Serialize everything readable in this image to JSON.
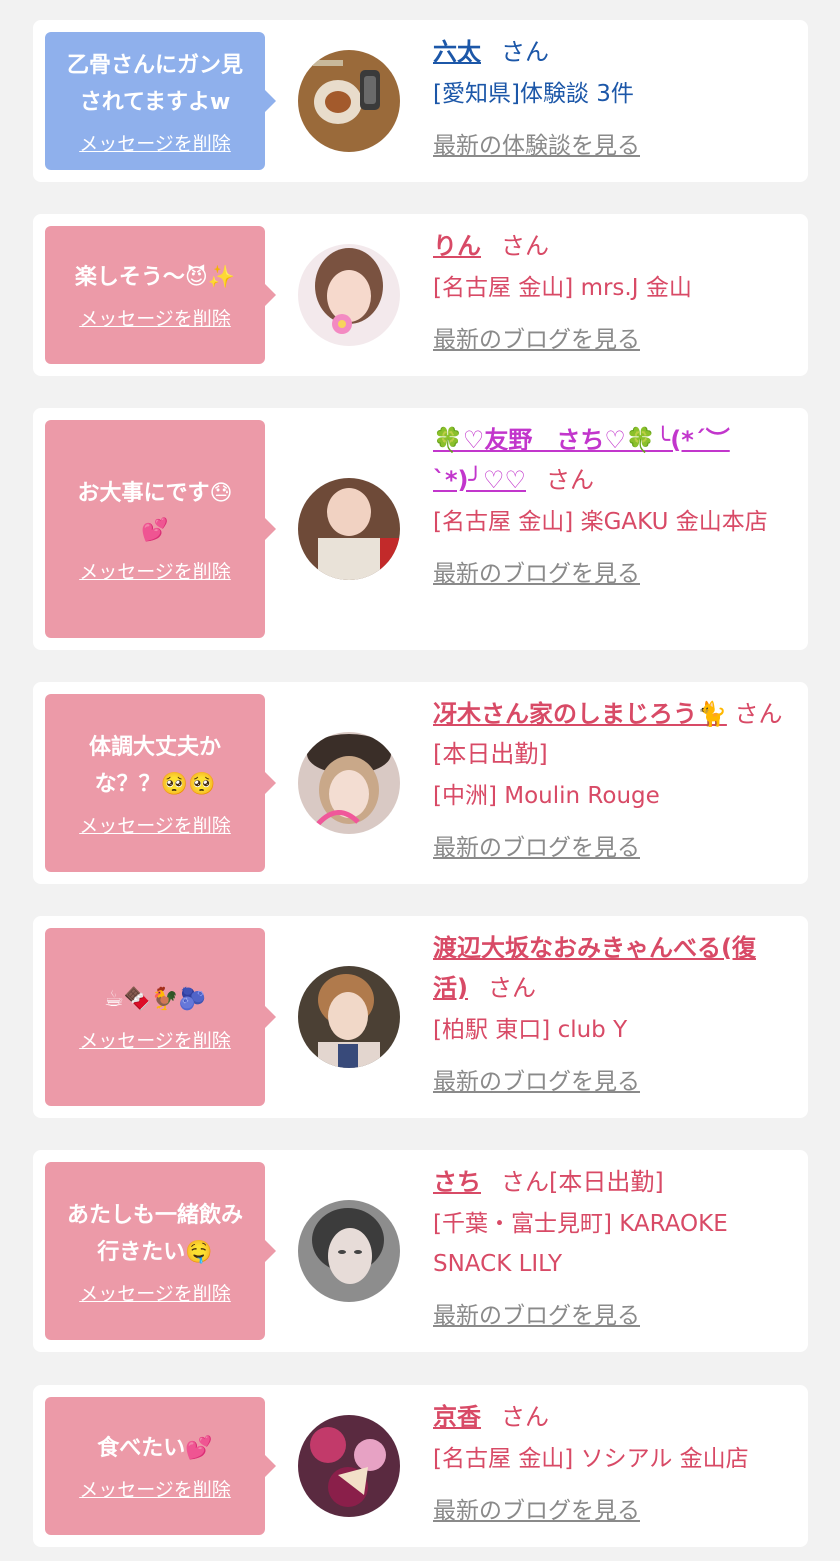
{
  "cards": [
    {
      "message": "乙骨さんにガン見\nされてますよw",
      "delete_label": "メッセージを削除",
      "name": "六太",
      "san": "さん",
      "shop": "[愛知県]体験談 3件",
      "latest": "最新の体験談を見る",
      "bubble_color": "#8fb0ec",
      "text_color": "#1c57a8"
    },
    {
      "message": "楽しそう〜😈✨",
      "delete_label": "メッセージを削除",
      "name": "りん",
      "san": "さん",
      "shop": "[名古屋 金山] mrs.J 金山",
      "latest": "最新のブログを見る",
      "bubble_color": "#ec9aa8",
      "text_color": "#d84a66"
    },
    {
      "message": "お大事にです😓\n💕",
      "delete_label": "メッセージを削除",
      "name": "🍀♡友野　さち♡🍀╰(*´︶`*)╯♡♡",
      "san": "さん",
      "shop": "[名古屋 金山] 楽GAKU 金山本店",
      "latest": "最新のブログを見る",
      "bubble_color": "#ec9aa8",
      "text_color": "#d84a66"
    },
    {
      "message": "体調大丈夫か\nな？？🥺🥺",
      "delete_label": "メッセージを削除",
      "name": "冴木さん家のしまじろう🐈",
      "san": "さん[本日出勤]",
      "shop": "[中洲] Moulin Rouge",
      "latest": "最新のブログを見る",
      "bubble_color": "#ec9aa8",
      "text_color": "#d84a66"
    },
    {
      "message": "☕🍫🐓🫐",
      "delete_label": "メッセージを削除",
      "name": "渡辺大坂なおみきゃんべる(復活)",
      "san": "さん",
      "shop": "[柏駅 東口] club Y",
      "latest": "最新のブログを見る",
      "bubble_color": "#ec9aa8",
      "text_color": "#d84a66"
    },
    {
      "message": "あたしも一緒飲み\n行きたい🤤",
      "delete_label": "メッセージを削除",
      "name": "さち",
      "san": "さん[本日出勤]",
      "shop": "[千葉・富士見町] KARAOKE SNACK LILY",
      "latest": "最新のブログを見る",
      "bubble_color": "#ec9aa8",
      "text_color": "#d84a66"
    },
    {
      "message": "食べたい💕",
      "delete_label": "メッセージを削除",
      "name": "京香",
      "san": "さん",
      "shop": "[名古屋 金山] ソシアル 金山店",
      "latest": "最新のブログを見る",
      "bubble_color": "#ec9aa8",
      "text_color": "#d84a66"
    }
  ]
}
